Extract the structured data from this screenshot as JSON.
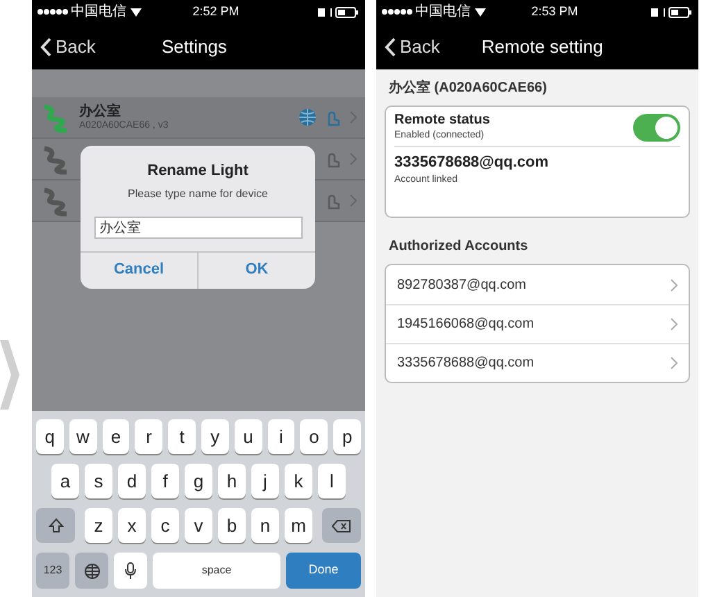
{
  "left_screen": {
    "status_bar": {
      "carrier": "中国电信",
      "time": "2:52 PM"
    },
    "nav": {
      "back": "Back",
      "title": "Settings"
    },
    "devices": [
      {
        "name": "办公室",
        "subtitle": "A020A60CAE66 , v3",
        "active": true
      },
      {
        "active": false
      },
      {
        "active": false
      }
    ],
    "dialog": {
      "title": "Rename Light",
      "message": "Please type name for device",
      "value": "办公室",
      "buttons": [
        "Cancel",
        "OK"
      ]
    },
    "keyboard": {
      "rows": [
        [
          "q",
          "w",
          "e",
          "r",
          "t",
          "y",
          "u",
          "i",
          "o",
          "p"
        ],
        [
          "a",
          "s",
          "d",
          "f",
          "g",
          "h",
          "j",
          "k",
          "l"
        ],
        [
          "z",
          "x",
          "c",
          "v",
          "b",
          "n",
          "m"
        ]
      ],
      "numbers_key": "123",
      "space_key": "space",
      "done_key": "Done"
    }
  },
  "right_screen": {
    "status_bar": {
      "carrier": "中国电信",
      "time": "2:53 PM"
    },
    "nav": {
      "back": "Back",
      "title": "Remote setting"
    },
    "heading": "办公室 (A020A60CAE66)",
    "remote_status": {
      "label": "Remote status",
      "detail": "Enabled (connected)",
      "on": true
    },
    "linked_account": {
      "email": "3335678688@qq.com",
      "detail": "Account linked"
    },
    "section_title": "Authorized Accounts",
    "accounts": [
      "892780387@qq.com",
      "1945166068@qq.com",
      "3335678688@qq.com"
    ]
  }
}
